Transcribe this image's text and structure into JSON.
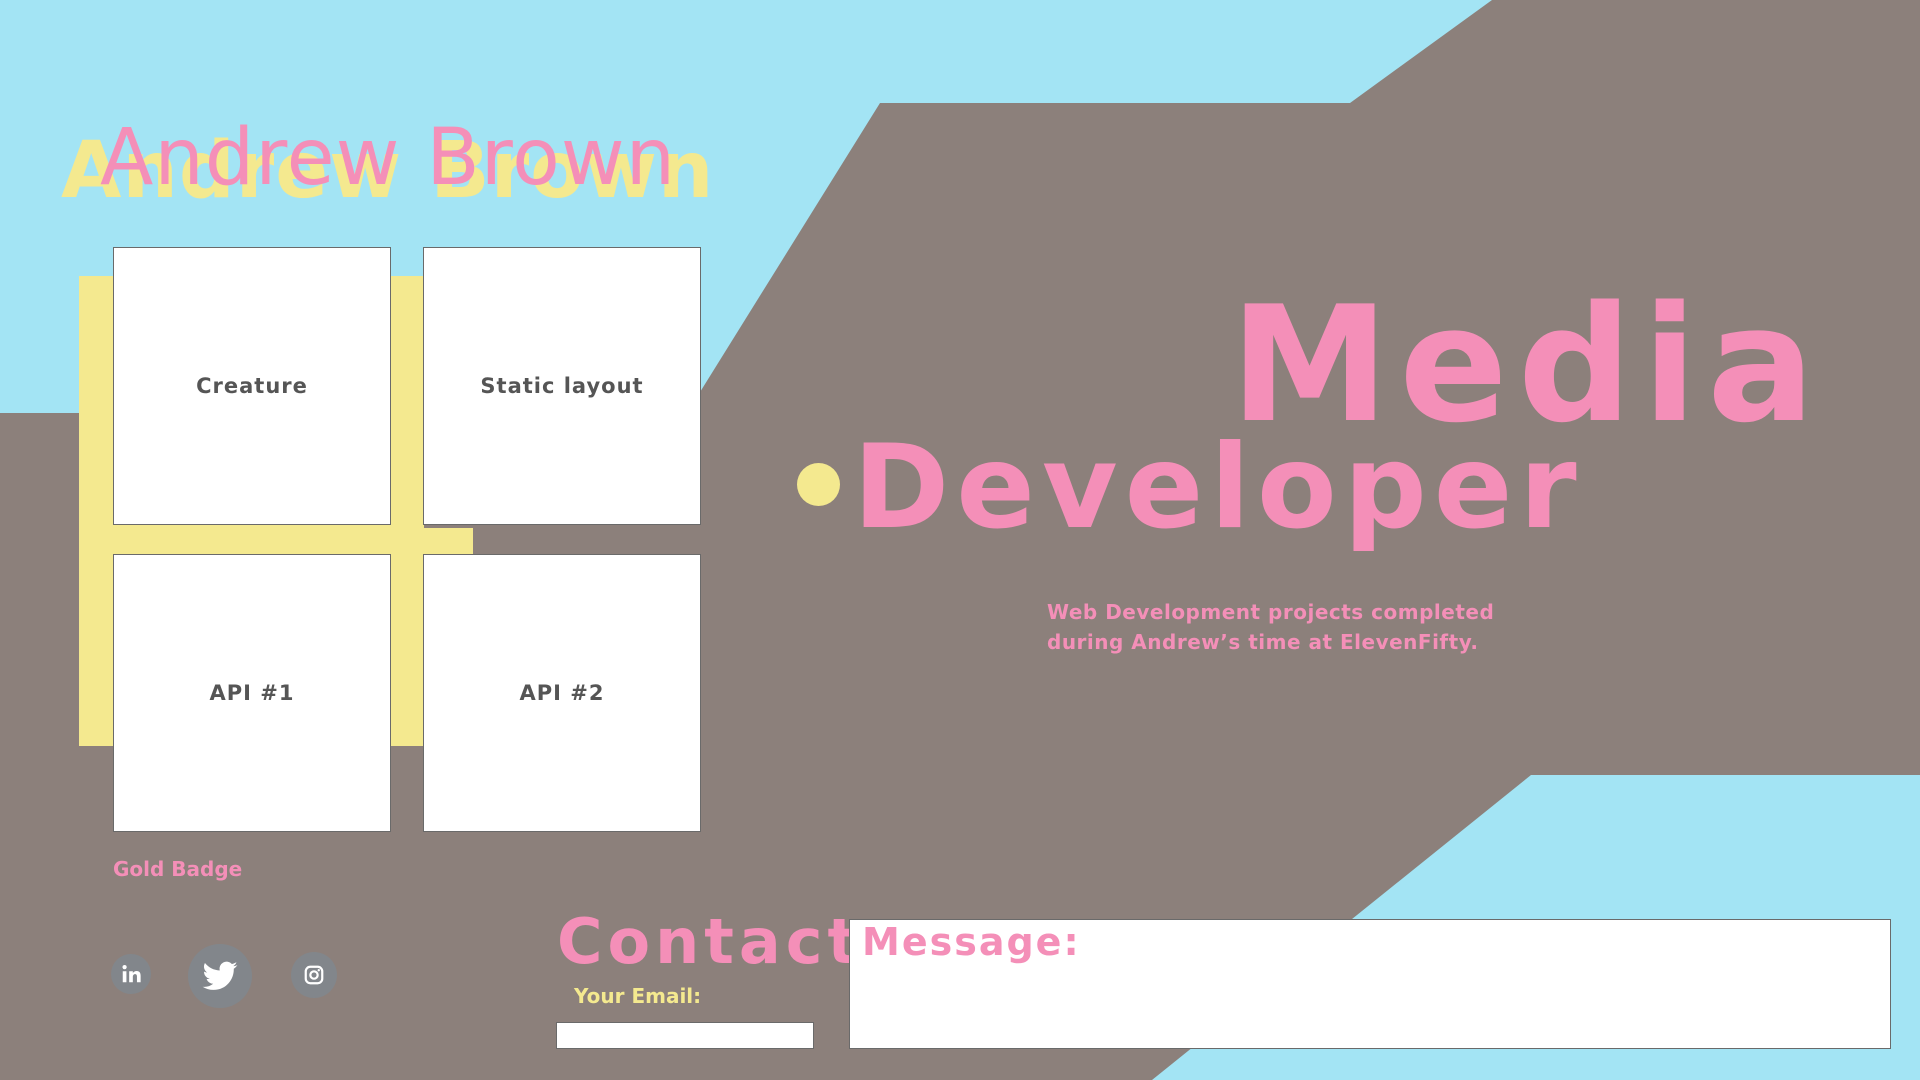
{
  "colors": {
    "sky": "#a3e4f4",
    "taupe": "#8c807b",
    "pink": "#f48fb8",
    "yellow": "#f4e98f",
    "tile_text": "#555555",
    "icon_bg": "#82868b"
  },
  "header": {
    "name": "Andrew Brown"
  },
  "projects": {
    "tiles": [
      {
        "label": "Creature"
      },
      {
        "label": "Static layout"
      },
      {
        "label": "API #1"
      },
      {
        "label": "API #2"
      }
    ],
    "badge": "Gold Badge"
  },
  "hero": {
    "line1": "Media",
    "line2": "Developer",
    "description": "Web Development projects completed during Andrew’s time at ElevenFifty."
  },
  "social": {
    "icons": [
      "linkedin-icon",
      "twitter-icon",
      "instagram-icon"
    ]
  },
  "contact": {
    "title": "Contact",
    "email_label": "Your Email:",
    "email_value": "",
    "message_label": "Message:",
    "message_value": ""
  }
}
